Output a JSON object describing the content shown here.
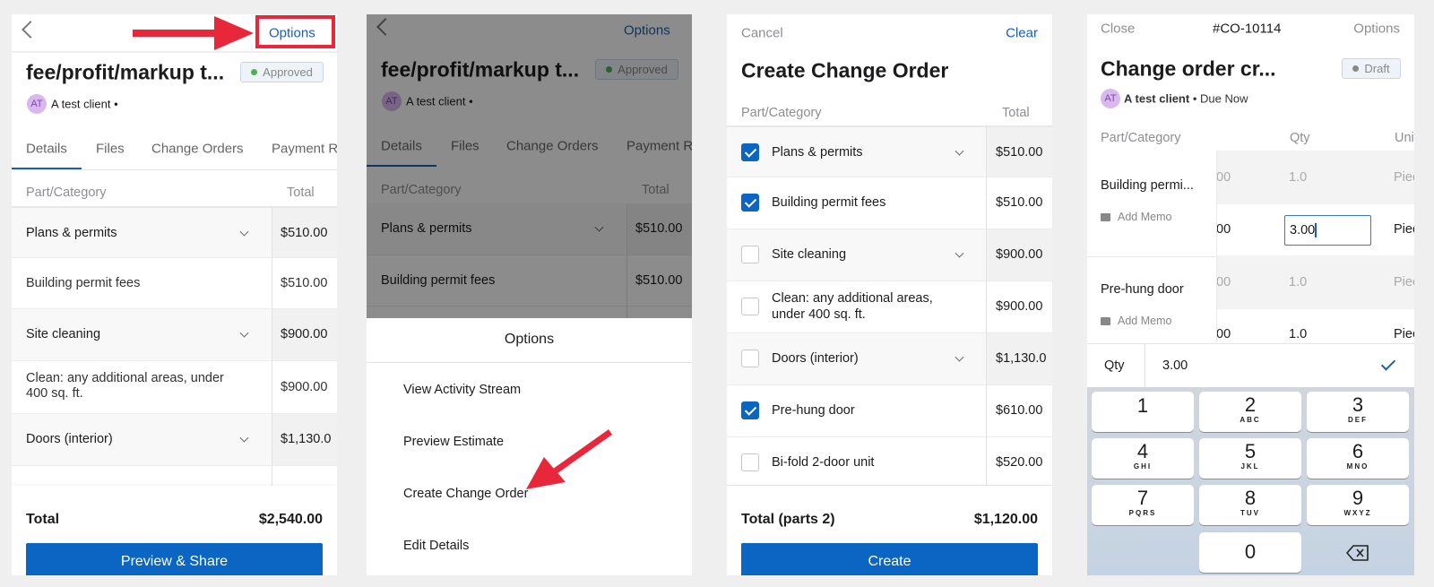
{
  "colors": {
    "accent": "#0a66c2",
    "annotation": "#e8283a",
    "approved": "#4caf50",
    "draft": "#888888"
  },
  "estimate": {
    "back_icon": "chevron-left-icon",
    "options": "Options",
    "title": "fee/profit/markup t...",
    "status": "Approved",
    "avatar": "AT",
    "client": "A test client •",
    "tabs": [
      "Details",
      "Files",
      "Change Orders",
      "Payment R"
    ],
    "col_part": "Part/Category",
    "col_total": "Total",
    "rows": [
      {
        "label": "Plans & permits",
        "total": "$510.00",
        "category": true
      },
      {
        "label": "Building permit fees",
        "total": "$510.00",
        "category": false
      },
      {
        "label": "Site cleaning",
        "total": "$900.00",
        "category": true
      },
      {
        "label": "Clean: any additional areas, under 400 sq. ft.",
        "total": "$900.00",
        "category": false
      },
      {
        "label": "Doors (interior)",
        "total": "$1,130.0",
        "category": true
      }
    ],
    "total_label": "Total",
    "total_value": "$2,540.00",
    "preview_button": "Preview & Share"
  },
  "options_sheet": {
    "title": "Options",
    "items": [
      "View Activity Stream",
      "Preview Estimate",
      "Create Change Order",
      "Edit Details"
    ]
  },
  "create_co": {
    "cancel": "Cancel",
    "clear": "Clear",
    "title": "Create Change Order",
    "col_part": "Part/Category",
    "col_total": "Total",
    "rows": [
      {
        "label": "Plans & permits",
        "total": "$510.00",
        "category": true,
        "checked": true
      },
      {
        "label": "Building permit fees",
        "total": "$510.00",
        "category": false,
        "checked": true
      },
      {
        "label": "Site cleaning",
        "total": "$900.00",
        "category": true,
        "checked": false
      },
      {
        "label": "Clean: any additional areas, under 400 sq. ft.",
        "total": "$900.00",
        "category": false,
        "checked": false
      },
      {
        "label": "Doors (interior)",
        "total": "$1,130.0",
        "category": true,
        "checked": false
      },
      {
        "label": "Pre-hung door",
        "total": "$610.00",
        "category": false,
        "checked": true
      },
      {
        "label": "Bi-fold 2-door unit",
        "total": "$520.00",
        "category": false,
        "checked": false
      }
    ],
    "total_label": "Total (parts 2)",
    "total_value": "$1,120.00",
    "create_button": "Create"
  },
  "change_order": {
    "close": "Close",
    "number": "#CO-10114",
    "options": "Options",
    "title": "Change order cr...",
    "status": "Draft",
    "avatar": "AT",
    "client": "A test client",
    "due": "• Due Now",
    "col_part": "Part/Category",
    "col_qty": "Qty",
    "col_unit": "Uni",
    "items": [
      {
        "name": "Building permi...",
        "memo": "Add Memo",
        "orig_amt": "00",
        "orig_qty": "1.0",
        "orig_unit": "Piec",
        "amt": "00",
        "qty": "3.00",
        "unit": "Piec"
      },
      {
        "name": "Pre-hung door",
        "memo": "Add Memo",
        "orig_amt": "00",
        "orig_qty": "1.0",
        "orig_unit": "Piec",
        "amt": "00",
        "qty": "1.0",
        "unit": "Piec"
      }
    ],
    "qty_bar": {
      "label": "Qty",
      "value": "3.00"
    },
    "keypad": [
      {
        "n": "1",
        "l": ""
      },
      {
        "n": "2",
        "l": "ABC"
      },
      {
        "n": "3",
        "l": "DEF"
      },
      {
        "n": "4",
        "l": "GHI"
      },
      {
        "n": "5",
        "l": "JKL"
      },
      {
        "n": "6",
        "l": "MNO"
      },
      {
        "n": "7",
        "l": "PQRS"
      },
      {
        "n": "8",
        "l": "TUV"
      },
      {
        "n": "9",
        "l": "WXYZ"
      },
      {
        "n": "0",
        "l": ""
      }
    ]
  }
}
